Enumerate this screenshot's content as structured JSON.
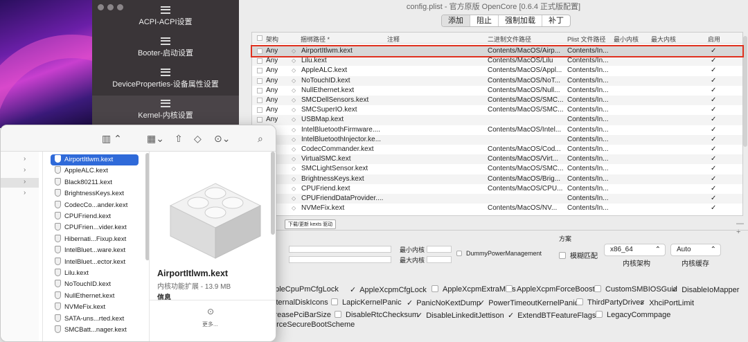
{
  "window": {
    "title": "config.plist - 官方原版 OpenCore [0.6.4 正式版配置]"
  },
  "sidebar": {
    "items": [
      "ACPI-ACPI设置",
      "Booter-启动设置",
      "DeviceProperties-设备属性设置",
      "Kernel-内核设置"
    ]
  },
  "segments": [
    "添加",
    "阻止",
    "强制加载",
    "补丁"
  ],
  "table": {
    "headers": [
      "架构",
      "捆绑路径 *",
      "注释",
      "二进制文件路径",
      "Plist 文件路径",
      "最小内核",
      "最大内核",
      "启用"
    ],
    "rows": [
      {
        "arch": "Any",
        "bundle": "AirportItlwm.kext",
        "exec": "Contents/MacOS/Airp...",
        "plist": "Contents/In...",
        "en": "✓"
      },
      {
        "arch": "Any",
        "bundle": "Lilu.kext",
        "exec": "Contents/MacOS/Lilu",
        "plist": "Contents/In...",
        "en": "✓"
      },
      {
        "arch": "Any",
        "bundle": "AppleALC.kext",
        "exec": "Contents/MacOS/Appl...",
        "plist": "Contents/In...",
        "en": "✓"
      },
      {
        "arch": "Any",
        "bundle": "NoTouchID.kext",
        "exec": "Contents/MacOS/NoT...",
        "plist": "Contents/In...",
        "en": "✓"
      },
      {
        "arch": "Any",
        "bundle": "NullEthernet.kext",
        "exec": "Contents/MacOS/Null...",
        "plist": "Contents/In...",
        "en": "✓"
      },
      {
        "arch": "Any",
        "bundle": "SMCDellSensors.kext",
        "exec": "Contents/MacOS/SMC...",
        "plist": "Contents/In...",
        "en": "✓"
      },
      {
        "arch": "Any",
        "bundle": "SMCSuperIO.kext",
        "exec": "Contents/MacOS/SMC...",
        "plist": "Contents/In...",
        "en": "✓"
      },
      {
        "arch": "Any",
        "bundle": "USBMap.kext",
        "exec": "",
        "plist": "Contents/In...",
        "en": "✓"
      },
      {
        "arch": "",
        "bundle": "IntelBluetoothFirmware....",
        "exec": "Contents/MacOS/Intel...",
        "plist": "Contents/In...",
        "en": "✓"
      },
      {
        "arch": "",
        "bundle": "IntelBluetoothInjector.ke...",
        "exec": "",
        "plist": "Contents/In...",
        "en": "✓"
      },
      {
        "arch": "",
        "bundle": "CodecCommander.kext",
        "exec": "Contents/MacOS/Cod...",
        "plist": "Contents/In...",
        "en": "✓"
      },
      {
        "arch": "",
        "bundle": "VirtualSMC.kext",
        "exec": "Contents/MacOS/Virt...",
        "plist": "Contents/In...",
        "en": "✓"
      },
      {
        "arch": "",
        "bundle": "SMCLightSensor.kext",
        "exec": "Contents/MacOS/SMC...",
        "plist": "Contents/In...",
        "en": "✓"
      },
      {
        "arch": "",
        "bundle": "BrightnessKeys.kext",
        "exec": "Contents/MacOS/Brig...",
        "plist": "Contents/In...",
        "en": "✓"
      },
      {
        "arch": "",
        "bundle": "CPUFriend.kext",
        "exec": "Contents/MacOS/CPU...",
        "plist": "Contents/In...",
        "en": "✓"
      },
      {
        "arch": "",
        "bundle": "CPUFriendDataProvider....",
        "exec": "",
        "plist": "Contents/In...",
        "en": "✓"
      },
      {
        "arch": "",
        "bundle": "NVMeFix.kext",
        "exec": "Contents/MacOS/NV...",
        "plist": "Contents/In...",
        "en": "✓"
      }
    ]
  },
  "lower": {
    "update_btn": "下载/更新 kexts 驱动",
    "emu_label": "U",
    "data_label": "ata",
    "mask_label": "ask",
    "min_kernel": "最小内核",
    "max_kernel": "最大内核",
    "dummy": "DummyPowerManagement",
    "scheme": "方案",
    "fuzzy": "模糊匹配",
    "arch_value": "x86_64",
    "arch_label": "内核架构",
    "cache_value": "Auto",
    "cache_label": "内核缓存",
    "quirks_row1": [
      {
        "t": "ppleCpuPmCfgLock",
        "c": false
      },
      {
        "t": "AppleXcpmCfgLock",
        "c": true
      },
      {
        "t": "AppleXcpmExtraMsrs",
        "c": false
      },
      {
        "t": "AppleXcpmForceBoost",
        "c": false
      },
      {
        "t": "CustomSMBIOSGuid",
        "c": false
      },
      {
        "t": "DisableIoMapper",
        "c": true
      }
    ],
    "quirks_row2": [
      {
        "t": "xternalDiskIcons",
        "c": false
      },
      {
        "t": "LapicKernelPanic",
        "c": false
      },
      {
        "t": "PanicNoKextDump",
        "c": true
      },
      {
        "t": "PowerTimeoutKernelPanic",
        "c": true
      },
      {
        "t": "ThirdPartyDrives",
        "c": false
      },
      {
        "t": "XhciPortLimit",
        "c": true
      }
    ],
    "quirks_row3": [
      {
        "t": "ncreasePciBarSize",
        "c": false
      },
      {
        "t": "DisableRtcChecksum",
        "c": false
      },
      {
        "t": "DisableLinkeditJettison",
        "c": true
      },
      {
        "t": "ExtendBTFeatureFlags",
        "c": true
      },
      {
        "t": "LegacyCommpage",
        "c": false
      }
    ],
    "quirks_row4": "orceSecureBootScheme"
  },
  "finder": {
    "files": [
      "AirportItlwm.kext",
      "AppleALC.kext",
      "Black80211.kext",
      "BrightnessKeys.kext",
      "CodecCo...ander.kext",
      "CPUFriend.kext",
      "CPUFrien...vider.kext",
      "Hibernati...Fixup.kext",
      "IntelBluet...ware.kext",
      "IntelBluet...ector.kext",
      "Lilu.kext",
      "NoTouchID.kext",
      "NullEthernet.kext",
      "NVMeFix.kext",
      "SATA-uns...rted.kext",
      "SMCBatt...nager.kext"
    ],
    "preview_name": "AirportItlwm.kext",
    "preview_kind": "内核功能扩展 - 13.9 MB",
    "info": "信息",
    "more": "更多..."
  }
}
